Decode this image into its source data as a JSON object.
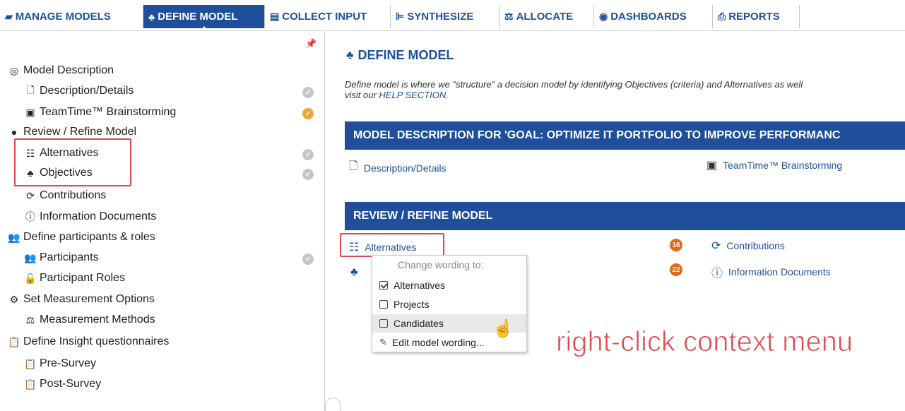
{
  "nav": {
    "tabs": [
      {
        "label": "MANAGE MODELS",
        "icon": "folder-icon"
      },
      {
        "label": "DEFINE MODEL",
        "icon": "hierarchy-icon"
      },
      {
        "label": "COLLECT INPUT",
        "icon": "keyboard-icon"
      },
      {
        "label": "SYNTHESIZE",
        "icon": "chart-icon"
      },
      {
        "label": "ALLOCATE",
        "icon": "scale-icon"
      },
      {
        "label": "DASHBOARDS",
        "icon": "dashboard-icon"
      },
      {
        "label": "REPORTS",
        "icon": "print-icon"
      }
    ],
    "active": "DEFINE MODEL"
  },
  "sidebar": {
    "items": [
      {
        "label": "Model Description",
        "icon": "target-icon"
      },
      {
        "label": "Description/Details",
        "icon": "document-icon"
      },
      {
        "label": "TeamTime™ Brainstorming",
        "icon": "presenter-icon"
      },
      {
        "label": "Review / Refine Model",
        "icon": "circle-icon"
      },
      {
        "label": "Alternatives",
        "icon": "list-icon"
      },
      {
        "label": "Objectives",
        "icon": "hierarchy-icon"
      },
      {
        "label": "Contributions",
        "icon": "sync-icon"
      },
      {
        "label": "Information Documents",
        "icon": "info-icon"
      },
      {
        "label": "Define participants & roles",
        "icon": "users-icon"
      },
      {
        "label": "Participants",
        "icon": "users-icon"
      },
      {
        "label": "Participant Roles",
        "icon": "unlock-icon"
      },
      {
        "label": "Set Measurement Options",
        "icon": "gears-icon"
      },
      {
        "label": "Measurement Methods",
        "icon": "scale-icon"
      },
      {
        "label": "Define Insight questionnaires",
        "icon": "clipboard-icon"
      },
      {
        "label": "Pre-Survey",
        "icon": "clipboard-icon"
      },
      {
        "label": "Post-Survey",
        "icon": "clipboard-icon"
      }
    ]
  },
  "main": {
    "title": "DEFINE MODEL",
    "intro_line1": "Define model is where we \"structure\" a decision model by identifying Objectives (criteria) and Alternatives as well",
    "intro_line2_prefix": "visit our ",
    "intro_link": "HELP SECTION",
    "intro_line2_suffix": ".",
    "section1_title": "MODEL DESCRIPTION FOR 'GOAL: OPTIMIZE IT PORTFOLIO TO IMPROVE PERFORMANC",
    "section1_links": [
      "Description/Details",
      "TeamTime™ Brainstorming"
    ],
    "section2_title": "REVIEW / REFINE MODEL",
    "alternatives_link": "Alternatives",
    "contributions_link": "Contributions",
    "contributions_count": "16",
    "info_docs_link": "Information Documents",
    "info_docs_count": "22"
  },
  "context_menu": {
    "header": "Change wording to:",
    "options": [
      {
        "label": "Alternatives",
        "checked": true
      },
      {
        "label": "Projects",
        "checked": false
      },
      {
        "label": "Candidates",
        "checked": false
      }
    ],
    "edit_label": "Edit model wording..."
  },
  "annotation": "right-click context menu",
  "colors": {
    "brand": "#1f4f9a",
    "highlight": "#e0474c",
    "badge": "#e0691b",
    "done": "#f0a533"
  }
}
